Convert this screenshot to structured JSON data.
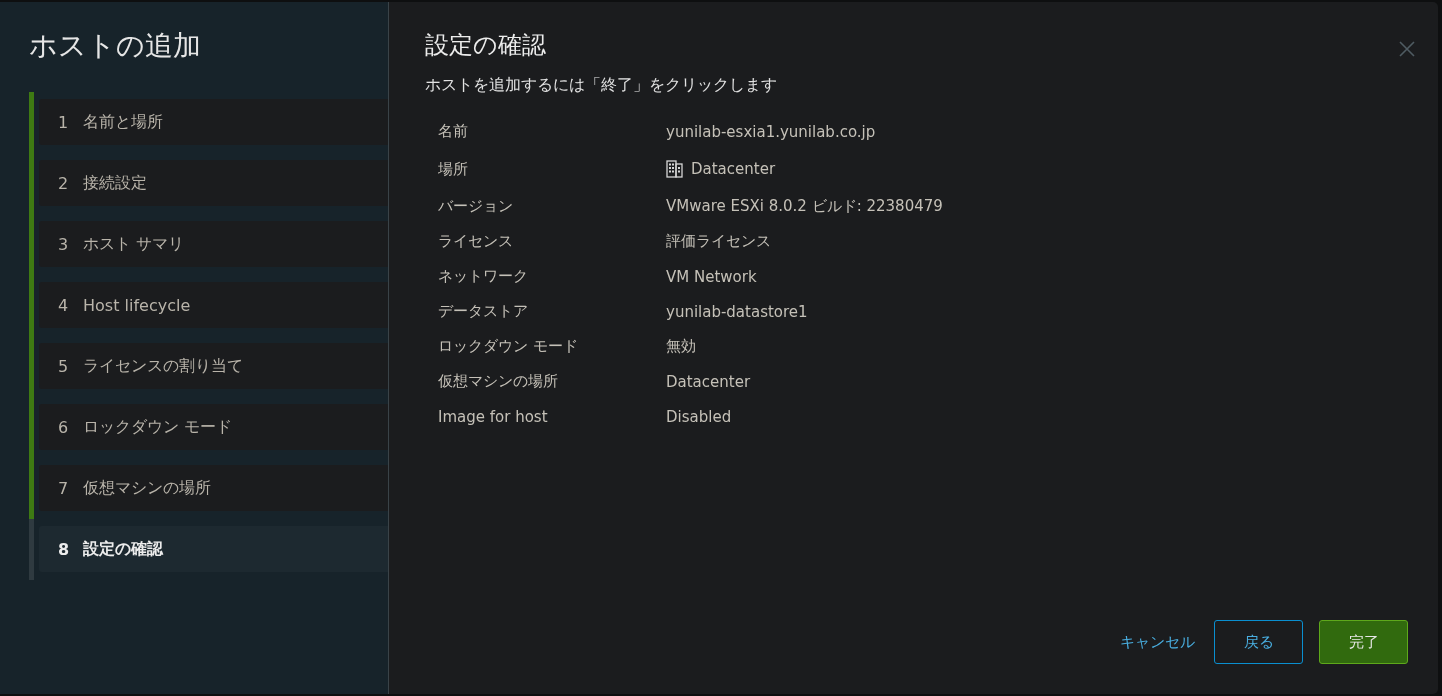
{
  "dialog": {
    "title": "ホストの追加",
    "steps": [
      {
        "number": "1",
        "label": "名前と場所",
        "completed": true,
        "selected": false
      },
      {
        "number": "2",
        "label": "接続設定",
        "completed": true,
        "selected": false
      },
      {
        "number": "3",
        "label": "ホスト サマリ",
        "completed": true,
        "selected": false
      },
      {
        "number": "4",
        "label": "Host lifecycle",
        "completed": true,
        "selected": false
      },
      {
        "number": "5",
        "label": "ライセンスの割り当て",
        "completed": true,
        "selected": false
      },
      {
        "number": "6",
        "label": "ロックダウン モード",
        "completed": true,
        "selected": false
      },
      {
        "number": "7",
        "label": "仮想マシンの場所",
        "completed": true,
        "selected": false
      },
      {
        "number": "8",
        "label": "設定の確認",
        "completed": false,
        "selected": true
      }
    ]
  },
  "page": {
    "title": "設定の確認",
    "instruction": "ホストを追加するには「終了」をクリックします",
    "fields": [
      {
        "kind": "text",
        "label": "名前",
        "value": "yunilab-esxia1.yunilab.co.jp"
      },
      {
        "kind": "datacenter",
        "label": "場所",
        "value": "Datacenter"
      },
      {
        "kind": "text",
        "label": "バージョン",
        "value": "VMware ESXi 8.0.2 ビルド: 22380479"
      },
      {
        "kind": "text",
        "label": "ライセンス",
        "value": "評価ライセンス"
      },
      {
        "kind": "text",
        "label": "ネットワーク",
        "value": "VM Network"
      },
      {
        "kind": "text",
        "label": "データストア",
        "value": "yunilab-datastore1"
      },
      {
        "kind": "text",
        "label": "ロックダウン モード",
        "value": "無効"
      },
      {
        "kind": "text",
        "label": "仮想マシンの場所",
        "value": "Datacenter"
      },
      {
        "kind": "text",
        "label": "Image for host",
        "value": "Disabled"
      }
    ]
  },
  "buttons": [
    {
      "kind": "cancel",
      "label": "キャンセル"
    },
    {
      "kind": "back",
      "label": "戻る"
    },
    {
      "kind": "finish",
      "label": "完了"
    }
  ]
}
